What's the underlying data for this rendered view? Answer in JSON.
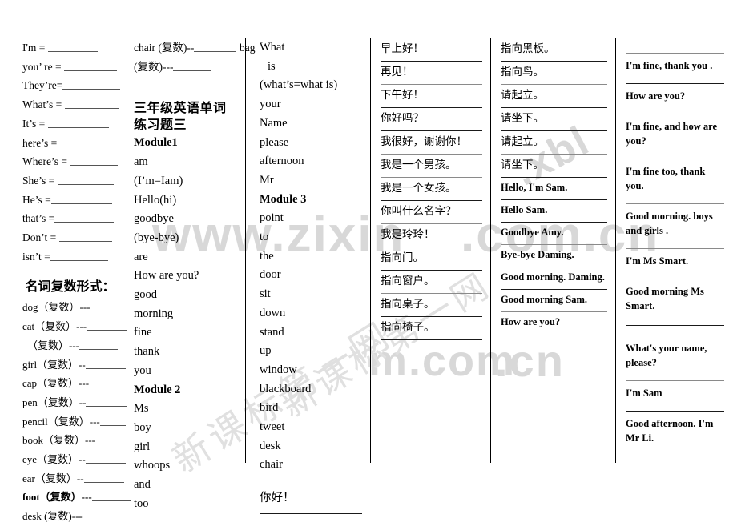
{
  "document": {
    "title": "三年级英语单词练习题三"
  },
  "watermark": {
    "url_parts": [
      "www.zixin",
      ".com.cn",
      ".xbl",
      "m.com",
      ".cn"
    ],
    "cn_text": "新课标第一网"
  },
  "col1": {
    "contractions": [
      "I'm = ",
      "you’ re = ",
      "They’re=",
      "What’s = ",
      "It’s = ",
      "here’s =",
      "Where’s = ",
      "She’s = ",
      "He’s =",
      "that’s =",
      "Don’t = ",
      "isn’t ="
    ],
    "plural_heading": "名词复数形式：",
    "plurals": [
      "dog（复数）--- ",
      "cat（复数）---",
      "（复数）---",
      "girl（复数）--",
      "cap（复数）---",
      "pen（复数）--",
      "pencil（复数）---",
      "book（复数）---",
      "eye（复数）--",
      "ear（复数）--",
      "foot（复数）---",
      "desk (复数)---"
    ],
    "plural_bold_index": 10
  },
  "col2": {
    "plurals": [
      "chair (复数)--",
      "(复数)---"
    ],
    "heading": "三年级英语单词练习题三",
    "module1_label": "Module1",
    "module1_words": [
      "am",
      "(I’m=Iam)",
      "Hello(hi)",
      "goodbye",
      "(bye-bye)",
      "are",
      "How are you?",
      "good",
      "morning",
      "fine",
      "thank",
      "you"
    ],
    "overlap_word": "boy",
    "module2_label": "Module 2",
    "module2_words": [
      "Ms",
      "boy",
      "girl",
      "whoops",
      "and",
      "too"
    ]
  },
  "col3": {
    "edge_fragment": "bag",
    "words_top": [
      "What",
      "is",
      "(what’s=what is)",
      "your",
      "Name",
      "please",
      "afternoon",
      "Mr"
    ],
    "module3_label": "Module 3",
    "module3_words": [
      "point",
      "to",
      "the",
      "door",
      "sit",
      "down",
      "stand",
      "up",
      "window",
      "blackboard",
      "bird",
      "tweet",
      "desk",
      "chair"
    ],
    "last_cn": "你好！"
  },
  "col4": {
    "items": [
      "早上好！",
      "再见！",
      "下午好！",
      "你好吗？",
      "我很好，谢谢你！",
      "我是一个男孩。",
      "我是一个女孩。",
      "你叫什么名字？",
      "我是玲玲！",
      "指向门。",
      "指向窗户。",
      "指向桌子。",
      "指向椅子。"
    ]
  },
  "col5": {
    "items_cn": [
      "指向黑板。",
      "指向鸟。",
      "请起立。",
      "请坐下。",
      "请起立。",
      "请坐下。"
    ],
    "items_en": [
      "Hello, I'm Sam.",
      "Hello Sam.",
      "Goodbye Amy.",
      "Bye-bye Daming.",
      "Good morning. Daming.",
      "Good morning Sam.",
      "How are you?"
    ]
  },
  "col6": {
    "items": [
      "I'm fine, thank you .",
      "How are you?",
      "I'm fine, and how are you?",
      "I'm fine too, thank you.",
      "Good morning. boys and girls .",
      "I'm Ms Smart.",
      "Good morning Ms Smart.",
      "What's your name, please?",
      "I'm Sam",
      "Good afternoon. I'm Mr Li."
    ]
  }
}
